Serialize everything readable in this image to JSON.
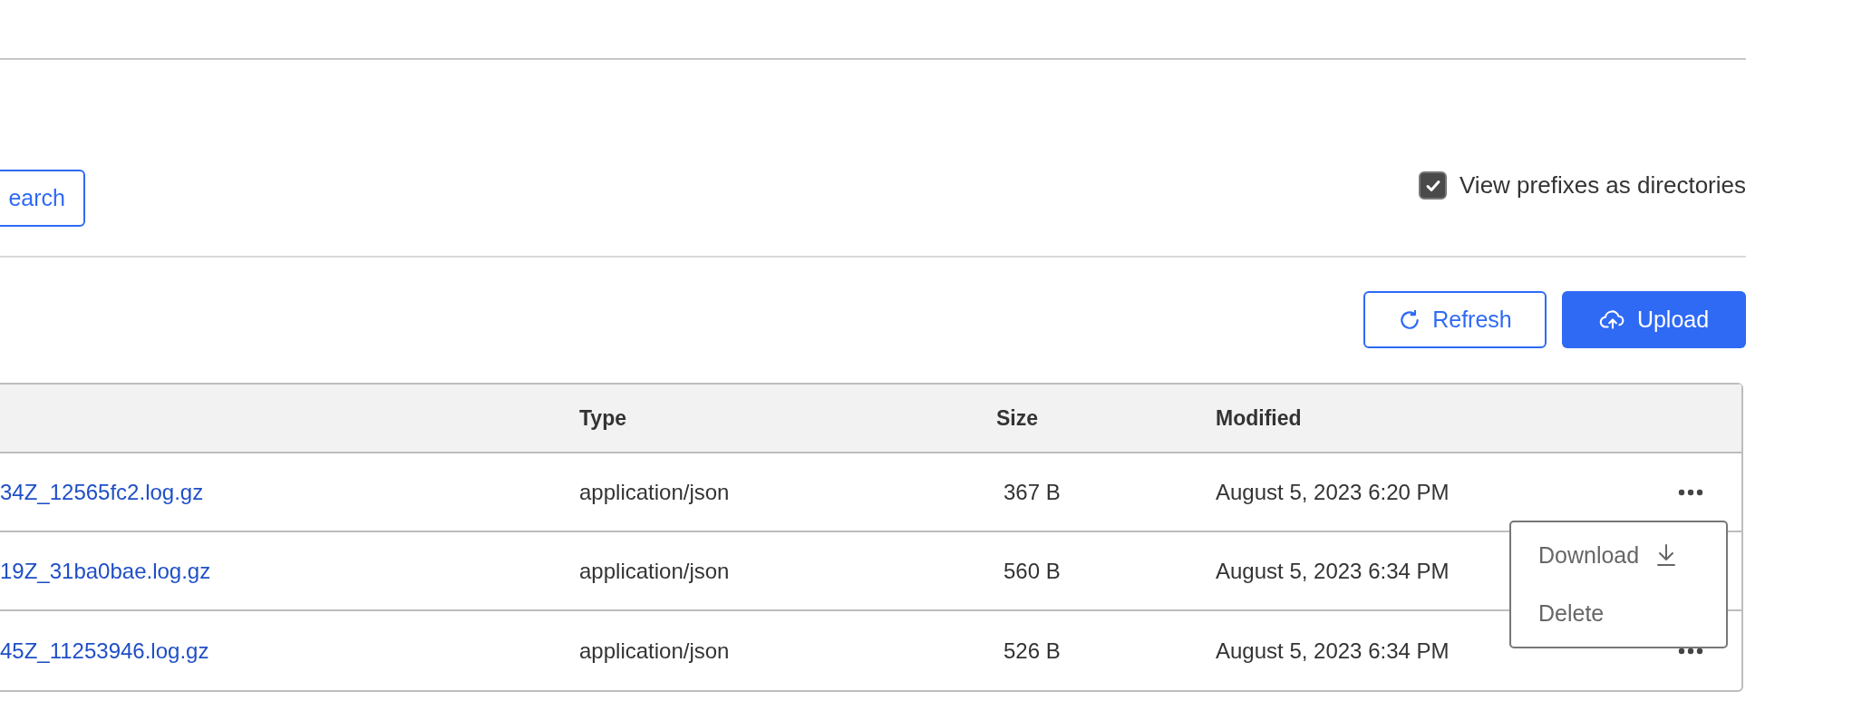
{
  "search_button": {
    "label": "earch"
  },
  "prefix_toggle": {
    "label": "View prefixes as directories",
    "checked": true
  },
  "toolbar": {
    "buttons": [
      {
        "label": "Refresh",
        "kind": "refresh"
      },
      {
        "label": "Upload",
        "kind": "upload"
      }
    ]
  },
  "table": {
    "columns": [
      "Type",
      "Size",
      "Modified"
    ],
    "rows": [
      {
        "name": "34Z_12565fc2.log.gz",
        "type": "application/json",
        "size": "367 B",
        "modified": "August 5, 2023 6:20 PM",
        "more_button": true
      },
      {
        "name": "19Z_31ba0bae.log.gz",
        "type": "application/json",
        "size": "560 B",
        "modified": "August 5, 2023 6:34 PM",
        "more_button": false
      },
      {
        "name": "45Z_11253946.log.gz",
        "type": "application/json",
        "size": "526 B",
        "modified": "August 5, 2023 6:34 PM",
        "more_button": true
      }
    ]
  },
  "row_menu": {
    "items": [
      {
        "label": "Download",
        "kind": "download"
      },
      {
        "label": "Delete",
        "kind": "plain"
      }
    ]
  }
}
